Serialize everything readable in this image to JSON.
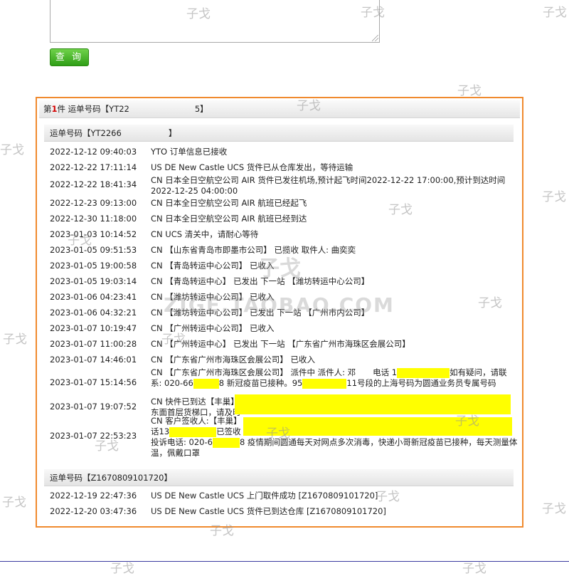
{
  "form": {
    "query_label": "查 询"
  },
  "package_header": {
    "prefix": "第",
    "index": "1",
    "suffix": "件 运单号码【YT22",
    "tail": "5】"
  },
  "sections": [
    {
      "title": "运单号码【YT2266",
      "title_tail": "】",
      "events": [
        {
          "time": "2022-12-12 09:40:03",
          "desc": "YTO 订单信息已接收"
        },
        {
          "time": "2022-12-22 17:11:14",
          "desc": "US DE New Castle UCS 货件已从仓库发出，等待运输"
        },
        {
          "time": "2022-12-22 18:41:34",
          "desc": "CN 日本全日空航空公司 AIR 货件已发往机场,预计起飞时间2022-12-22 17:00:00,预计到达时间2022-12-25 04:00:00"
        },
        {
          "time": "2022-12-23 09:13:00",
          "desc": "CN 日本全日空航空公司 AIR 航班已经起飞"
        },
        {
          "time": "2022-12-30 11:18:00",
          "desc": "CN 日本全日空航空公司 AIR 航班已经到达"
        },
        {
          "time": "2023-01-03 10:14:52",
          "desc": "CN UCS 清关中，请耐心等待"
        },
        {
          "time": "2023-01-05 09:51:53",
          "desc": "CN 【山东省青岛市即墨市公司】 已揽收 取件人: 曲奕奕"
        },
        {
          "time": "2023-01-05 19:00:58",
          "desc": "CN 【青岛转运中心公司】 已收入"
        },
        {
          "time": "2023-01-05 19:03:14",
          "desc": "CN 【青岛转运中心】 已发出 下一站 【潍坊转运中心公司】"
        },
        {
          "time": "2023-01-06 04:23:41",
          "desc": "CN 【潍坊转运中心公司】 已收入"
        },
        {
          "time": "2023-01-06 04:32:21",
          "desc": "CN 【潍坊转运中心公司】 已发出 下一站 【广州市内公司】"
        },
        {
          "time": "2023-01-07 10:19:47",
          "desc": "CN 【广州转运中心公司】 已收入"
        },
        {
          "time": "2023-01-07 11:00:28",
          "desc": "CN 【广州转运中心】 已发出 下一站 【广东省广州市海珠区会展公司】"
        },
        {
          "time": "2023-01-07 14:46:01",
          "desc": "CN 【广东省广州市海珠区会展公司】 已收入"
        }
      ],
      "event_1514": {
        "time": "2023-01-07 15:14:56",
        "line1_a": "CN 【广东省广州市海珠区会展公司】 派件中 派件人: 邓",
        "line1_b": "电话 1",
        "line1_c": "如有疑问，请联",
        "line2_a": "系: 020-66",
        "line2_b": "8 新冠疫苗已接种。95",
        "line2_c": "11号段的上海号码为圆通业务员专属号码"
      },
      "event_1907": {
        "time": "2023-01-07 19:07:52",
        "line1": "CN 快件已到达【丰巢】",
        "line2": "东面首层货梯口，请及时"
      },
      "event_2253": {
        "time": "2023-01-07 22:53:23",
        "line1": "CN 客户签收人:【丰巢】",
        "line2_a": "话13",
        "line2_b": "已签收",
        "line3_a": "投诉电话: 020-6",
        "line3_b": "8 疫情期间圆通每天对网点多次消毒，快递小哥新冠疫苗已接种，每天测量体",
        "line4": "温，佩戴口罩"
      }
    },
    {
      "title": "运单号码【Z1670809101720】",
      "events": [
        {
          "time": "2022-12-19 22:47:36",
          "desc": "US DE New Castle UCS 上门取件成功 [Z1670809101720]"
        },
        {
          "time": "2022-12-20 03:47:36",
          "desc": "US DE New Castle UCS 货件已到达仓库 [Z1670809101720]"
        }
      ]
    }
  ],
  "watermark": {
    "glyph": "子戈",
    "big_glyph": "子戈",
    "url": "ZIGE.TAOBAO.COM"
  },
  "colors": {
    "panel_border": "#f08a2e",
    "button_green": "#3fae1f",
    "redaction": "#ffff00",
    "index_red": "#d40000"
  }
}
